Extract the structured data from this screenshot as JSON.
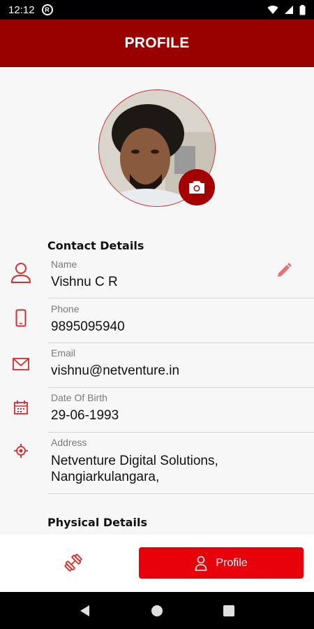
{
  "status_bar": {
    "time": "12:12",
    "app_icon_letter": "R"
  },
  "header": {
    "title": "PROFILE"
  },
  "profile": {
    "camera_icon": "camera-icon",
    "avatar": "profile-photo"
  },
  "contact_section": {
    "title": "Contact Details",
    "fields": [
      {
        "icon": "person-icon",
        "label": "Name",
        "value": "Vishnu C R"
      },
      {
        "icon": "phone-icon",
        "label": "Phone",
        "value": "9895095940"
      },
      {
        "icon": "mail-icon",
        "label": "Email",
        "value": "vishnu@netventure.in"
      },
      {
        "icon": "calendar-icon",
        "label": "Date Of Birth",
        "value": "29-06-1993"
      },
      {
        "icon": "location-icon",
        "label": "Address",
        "value_line1": "Netventure Digital Solutions,",
        "value_line2": "Nangiarkulangara,"
      }
    ]
  },
  "physical_section": {
    "title": "Physical Details"
  },
  "bottom_nav": {
    "fitness_icon": "dumbbell-icon",
    "profile_label": "Profile"
  },
  "colors": {
    "primary": "#990000",
    "accent": "#e8000b",
    "icon_red": "#d32f2f",
    "background": "#f7f7f7"
  }
}
